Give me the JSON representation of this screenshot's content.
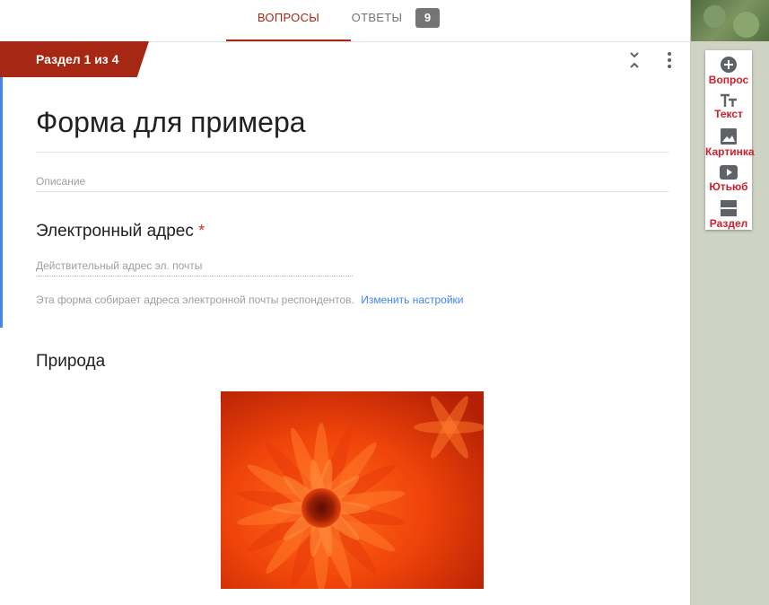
{
  "tabs": {
    "questions": "ВОПРОСЫ",
    "answers": "ОТВЕТЫ",
    "answers_count": "9"
  },
  "section": {
    "label": "Раздел 1 из 4"
  },
  "form": {
    "title": "Форма для примера",
    "description_placeholder": "Описание",
    "email_question": "Электронный адрес",
    "required_mark": "*",
    "email_placeholder": "Действительный адрес эл. почты",
    "collect_note": "Эта форма собирает адреса электронной почты респондентов.",
    "settings_link": "Изменить настройки",
    "image_title": "Природа"
  },
  "toolbar": {
    "question": "Вопрос",
    "text": "Текст",
    "image": "Картинка",
    "video": "Ютьюб",
    "section": "Раздел"
  },
  "colors": {
    "accent": "#a52714",
    "link": "#4285f4",
    "toolbar_label": "#d01f2c"
  }
}
